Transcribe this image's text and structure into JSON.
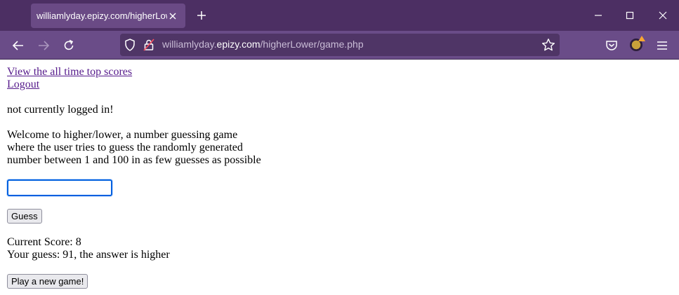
{
  "browser": {
    "tab_title": "williamlyday.epizy.com/higherLower/game.php",
    "url_prefix": "williamlyday.",
    "url_domain": "epizy.com",
    "url_path": "/higherLower/game.php",
    "icons": [
      "close-icon",
      "plus-icon",
      "minimize-icon",
      "maximize-icon",
      "window-close-icon",
      "back-icon",
      "forward-icon",
      "reload-icon",
      "shield-icon",
      "lock-icon",
      "star-icon",
      "pocket-icon",
      "extension-avatar-icon",
      "menu-icon"
    ],
    "colors": {
      "tabbar": "#4c2f63",
      "toolbar": "#6a4c88",
      "urlbar": "#4f3566"
    }
  },
  "page": {
    "links": {
      "top_scores": "View the all time top scores",
      "logout": "Logout"
    },
    "login_status": "not currently logged in!",
    "intro_line1": "Welcome to higher/lower, a number guessing game",
    "intro_line2": "where the user tries to guess the randomly generated",
    "intro_line3": "number between 1 and 100 in as few guesses as possible",
    "guess_input_value": "",
    "guess_button": "Guess",
    "current_score": "Current Score: 8",
    "guess_feedback": "Your guess: 91, the answer is higher",
    "new_game_button": "Play a new game!"
  }
}
